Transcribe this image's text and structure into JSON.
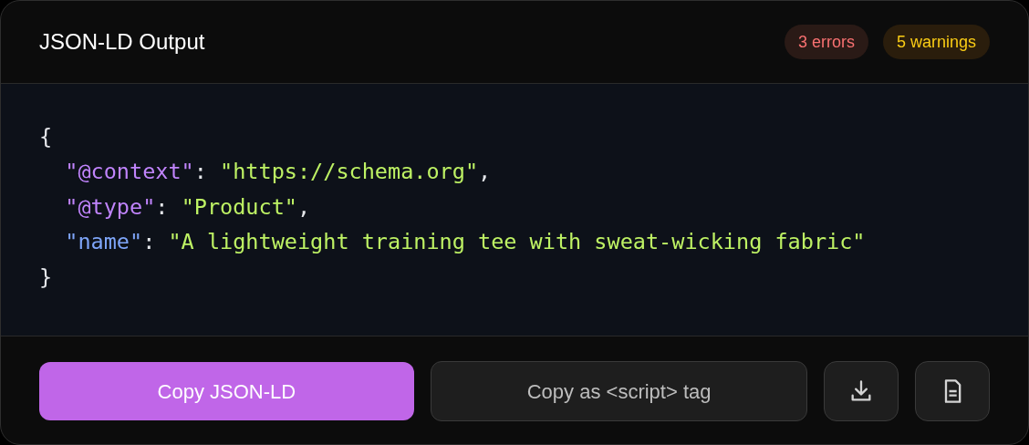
{
  "header": {
    "title": "JSON-LD Output",
    "badges": [
      {
        "label": "3 errors",
        "kind": "error"
      },
      {
        "label": "5 warnings",
        "kind": "warning"
      }
    ]
  },
  "code": {
    "lines": [
      {
        "tokens": [
          {
            "text": "{",
            "color": "#e5e7eb"
          }
        ],
        "children": [
          {
            "tokens": [
              {
                "text": "\"@context\"",
                "color": "#c084fc"
              },
              {
                "text": ": ",
                "color": "#e5e7eb"
              },
              {
                "text": "\"https://schema.org\"",
                "color": "#bef264"
              },
              {
                "text": ",",
                "color": "#e5e7eb"
              }
            ]
          },
          {
            "tokens": [
              {
                "text": "\"@type\"",
                "color": "#c084fc"
              },
              {
                "text": ": ",
                "color": "#e5e7eb"
              },
              {
                "text": "\"Product\"",
                "color": "#bef264"
              },
              {
                "text": ",",
                "color": "#e5e7eb"
              }
            ]
          },
          {
            "tokens": [
              {
                "text": "\"name\"",
                "color": "#7ea5f8"
              },
              {
                "text": ": ",
                "color": "#e5e7eb"
              },
              {
                "text": "\"A lightweight training tee with sweat-wicking fabric\"",
                "color": "#bef264"
              }
            ]
          }
        ]
      },
      {
        "tokens": [
          {
            "text": "}",
            "color": "#e5e7eb"
          }
        ]
      }
    ]
  },
  "actions": [
    {
      "kind": "primary",
      "label": "Copy JSON-LD"
    },
    {
      "kind": "secondary",
      "label": "Copy as <script> tag"
    },
    {
      "kind": "download-icon"
    },
    {
      "kind": "file-icon"
    }
  ]
}
